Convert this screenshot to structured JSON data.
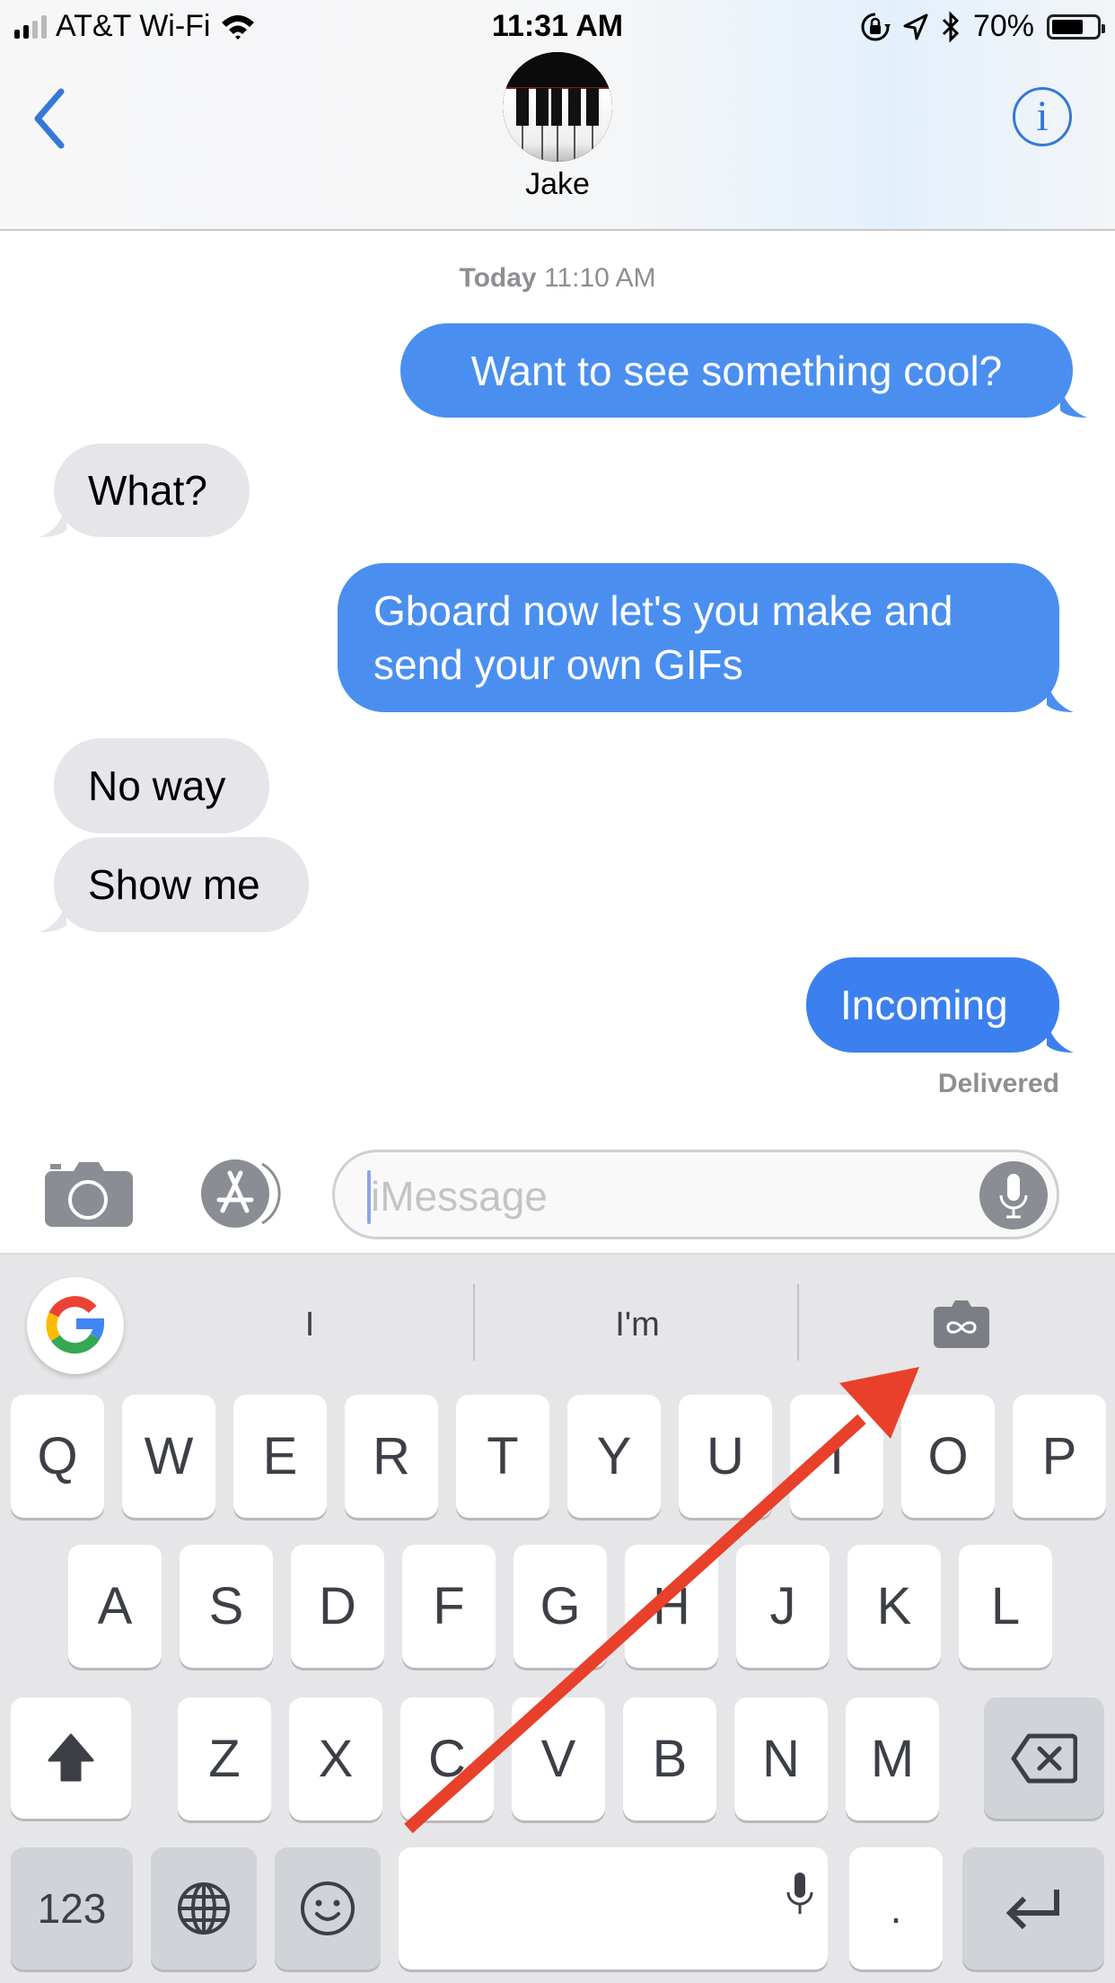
{
  "status_bar": {
    "carrier": "AT&T Wi-Fi",
    "time": "11:31 AM",
    "battery_percent": "70%",
    "battery_level": 0.7,
    "signal_bars_active": 2,
    "signal_bars_total": 4,
    "icons": [
      "signal-icon",
      "wifi-icon",
      "orientation-lock-icon",
      "location-icon",
      "bluetooth-icon",
      "battery-icon"
    ]
  },
  "nav": {
    "back_icon": "chevron-left-icon",
    "contact_name": "Jake",
    "avatar": "piano-keys-avatar",
    "info_label": "i"
  },
  "conversation": {
    "timestamp_day": "Today",
    "timestamp_time": "11:10 AM",
    "messages": [
      {
        "direction": "outgoing",
        "text": "Want to see something cool?"
      },
      {
        "direction": "incoming",
        "text": "What?"
      },
      {
        "direction": "outgoing",
        "text": "Gboard now let's you make and send your own GIFs"
      },
      {
        "direction": "incoming",
        "text": "No way"
      },
      {
        "direction": "incoming",
        "text": "Show me"
      },
      {
        "direction": "outgoing",
        "text": "Incoming"
      }
    ],
    "status": "Delivered"
  },
  "composer": {
    "placeholder": "iMessage",
    "value": "",
    "camera_icon": "camera-icon",
    "apps_icon": "app-store-icon",
    "mic_icon": "microphone-icon"
  },
  "keyboard": {
    "suggestions": [
      "I",
      "I'm"
    ],
    "google_icon": "google-g-icon",
    "gif_icon": "gif-camera-icon",
    "rows": [
      [
        "Q",
        "W",
        "E",
        "R",
        "T",
        "Y",
        "U",
        "I",
        "O",
        "P"
      ],
      [
        "A",
        "S",
        "D",
        "F",
        "G",
        "H",
        "J",
        "K",
        "L"
      ],
      [
        "Z",
        "X",
        "C",
        "V",
        "B",
        "N",
        "M"
      ]
    ],
    "numbers_label": "123",
    "period_label": ".",
    "space_label": ""
  },
  "annotation": {
    "type": "arrow",
    "color": "#e8402a",
    "points_to": "gif-camera-button"
  },
  "colors": {
    "accent": "#3478d8",
    "outgoing_bubble": "#4a8ff0",
    "incoming_bubble": "#e5e5ea",
    "keyboard_bg": "#e6e6e8"
  }
}
